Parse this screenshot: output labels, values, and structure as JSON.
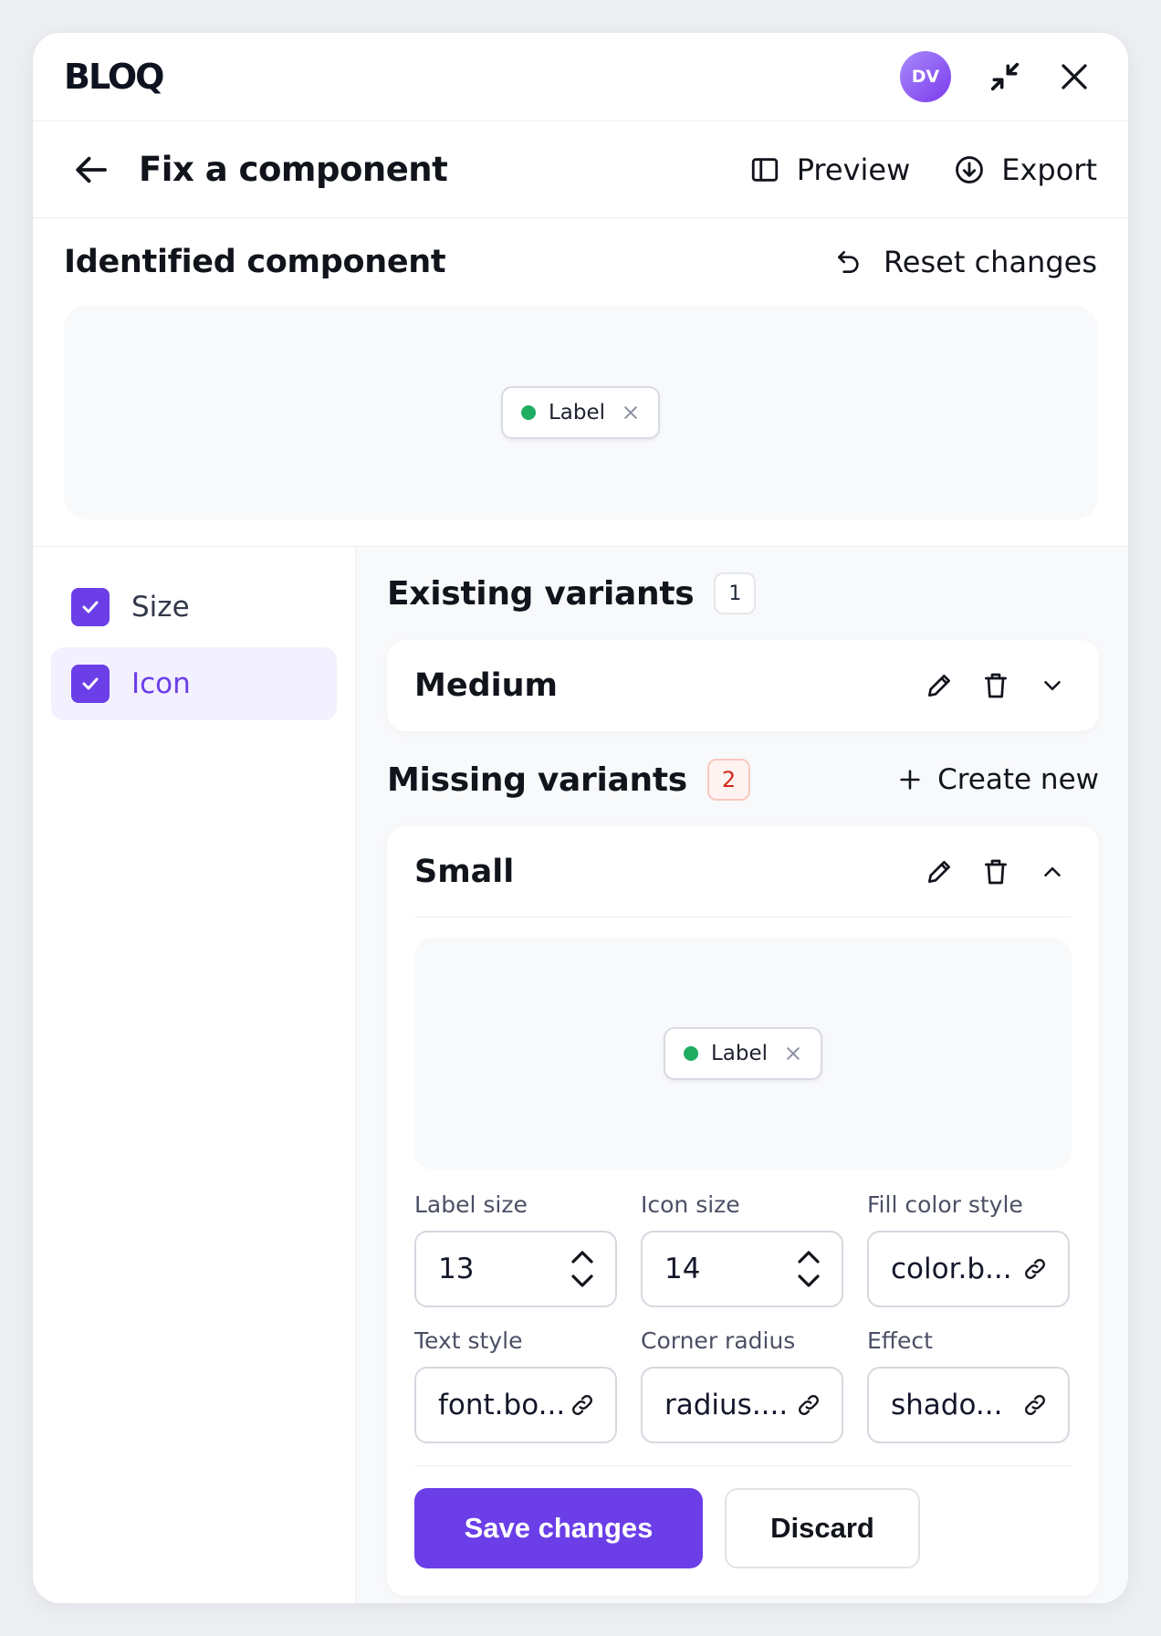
{
  "app": {
    "logo": "BLOQ",
    "avatar_initials": "DV"
  },
  "icons": {
    "minimize": "minimize-arrows-icon",
    "close": "close-icon",
    "back": "arrow-left-icon",
    "preview": "sidebar-panel-icon",
    "export": "download-circle-icon",
    "reset": "undo-icon",
    "edit": "pencil-icon",
    "delete": "trash-icon",
    "chevron_down": "chevron-down-icon",
    "chevron_up": "chevron-up-icon",
    "plus": "plus-icon",
    "link": "link-icon",
    "stepper": "stepper-arrows-icon",
    "check": "check-icon"
  },
  "header": {
    "title": "Fix a component",
    "preview_label": "Preview",
    "export_label": "Export"
  },
  "identified": {
    "title": "Identified component",
    "reset_label": "Reset changes",
    "chip_label": "Label"
  },
  "sidebar": {
    "items": [
      {
        "label": "Size",
        "checked": true
      },
      {
        "label": "Icon",
        "checked": true
      }
    ]
  },
  "existing": {
    "title": "Existing variants",
    "count": "1",
    "variants": [
      {
        "name": "Medium"
      }
    ]
  },
  "missing": {
    "title": "Missing variants",
    "count": "2",
    "create_label": "Create new",
    "variant": {
      "name": "Small",
      "chip_label": "Label",
      "fields": [
        {
          "label": "Label size",
          "value": "13"
        },
        {
          "label": "Icon size",
          "value": "14"
        },
        {
          "label": "Fill color style",
          "value": "color.b..."
        },
        {
          "label": "Text style",
          "value": "font.bo..."
        },
        {
          "label": "Corner radius",
          "value": "radius...."
        },
        {
          "label": "Effect",
          "value": "shado..."
        }
      ],
      "save_label": "Save changes",
      "discard_label": "Discard"
    }
  },
  "colors": {
    "accent": "#6b3ee8",
    "status_dot": "#1fad62",
    "missing_badge": "#d0281a"
  }
}
